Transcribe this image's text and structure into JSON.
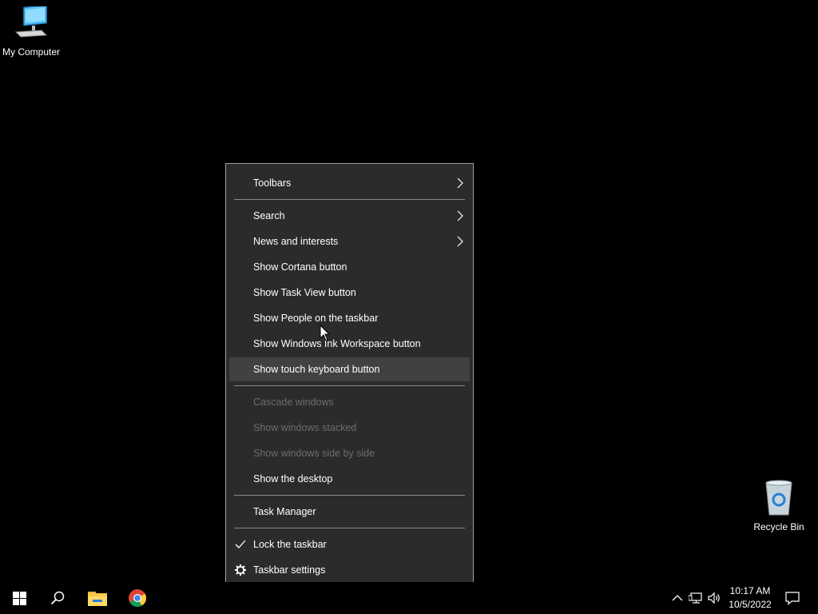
{
  "desktop": {
    "icons": [
      {
        "label": "My Computer"
      },
      {
        "label": "Recycle Bin"
      }
    ]
  },
  "context_menu": {
    "items": [
      {
        "label": "Toolbars",
        "has_submenu": true,
        "enabled": true
      },
      {
        "label": "Search",
        "has_submenu": true,
        "enabled": true
      },
      {
        "label": "News and interests",
        "has_submenu": true,
        "enabled": true
      },
      {
        "label": "Show Cortana button",
        "enabled": true
      },
      {
        "label": "Show Task View button",
        "enabled": true
      },
      {
        "label": "Show People on the taskbar",
        "enabled": true
      },
      {
        "label": "Show Windows Ink Workspace button",
        "enabled": true
      },
      {
        "label": "Show touch keyboard button",
        "enabled": true,
        "highlighted": true
      },
      {
        "label": "Cascade windows",
        "enabled": false
      },
      {
        "label": "Show windows stacked",
        "enabled": false
      },
      {
        "label": "Show windows side by side",
        "enabled": false
      },
      {
        "label": "Show the desktop",
        "enabled": true
      },
      {
        "label": "Task Manager",
        "enabled": true
      },
      {
        "label": "Lock the taskbar",
        "enabled": true,
        "checked": true
      },
      {
        "label": "Taskbar settings",
        "enabled": true,
        "icon": "gear-icon"
      }
    ]
  },
  "taskbar": {
    "pinned": [
      {
        "name": "start-button",
        "icon": "windows-logo-icon"
      },
      {
        "name": "search-button",
        "icon": "search-icon"
      },
      {
        "name": "file-explorer-button",
        "icon": "folder-icon"
      },
      {
        "name": "chrome-button",
        "icon": "chrome-icon"
      }
    ],
    "tray": {
      "icons": [
        "chevron-up-icon",
        "network-icon",
        "volume-icon",
        "notification-icon"
      ],
      "time": "10:17 AM",
      "date": "10/5/2022"
    }
  },
  "colors": {
    "menu_bg": "#2b2b2b",
    "menu_hover": "#414141",
    "disabled_text": "#6d6d6d",
    "desktop_bg": "#000000"
  }
}
